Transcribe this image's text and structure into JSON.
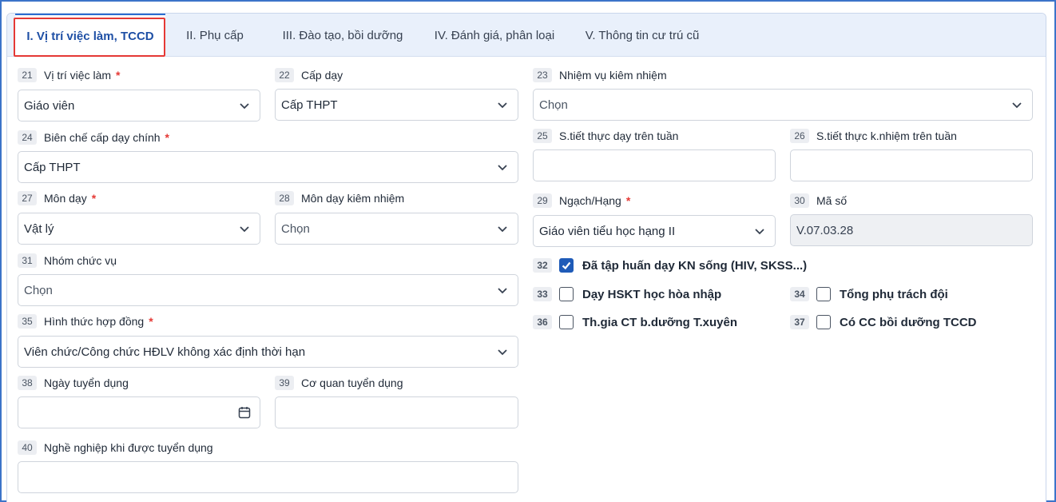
{
  "tabs": [
    {
      "label": "I. Vị trí việc làm, TCCD",
      "active": true
    },
    {
      "label": "II. Phụ cấp"
    },
    {
      "label": "III. Đào tạo, bồi dưỡng"
    },
    {
      "label": "IV. Đánh giá, phân loại"
    },
    {
      "label": "V. Thông tin cư trú cũ"
    }
  ],
  "fields": {
    "f21": {
      "num": "21",
      "label": "Vị trí việc làm",
      "required": "*",
      "value": "Giáo viên"
    },
    "f22": {
      "num": "22",
      "label": "Cấp dạy",
      "value": "Cấp THPT"
    },
    "f23": {
      "num": "23",
      "label": "Nhiệm vụ kiêm nhiệm",
      "value": "Chọn"
    },
    "f24": {
      "num": "24",
      "label": "Biên chế cấp dạy chính",
      "required": "*",
      "value": "Cấp THPT"
    },
    "f25": {
      "num": "25",
      "label": "S.tiết thực dạy trên tuần",
      "value": ""
    },
    "f26": {
      "num": "26",
      "label": "S.tiết thực k.nhiệm trên tuần",
      "value": ""
    },
    "f27": {
      "num": "27",
      "label": "Môn dạy",
      "required": "*",
      "value": "Vật lý"
    },
    "f28": {
      "num": "28",
      "label": "Môn dạy kiêm nhiệm",
      "value": "Chọn"
    },
    "f29": {
      "num": "29",
      "label": "Ngạch/Hạng",
      "required": "*",
      "value": "Giáo viên tiểu học hạng II"
    },
    "f30": {
      "num": "30",
      "label": "Mã số",
      "value": "V.07.03.28"
    },
    "f31": {
      "num": "31",
      "label": "Nhóm chức vụ",
      "value": "Chọn"
    },
    "f35": {
      "num": "35",
      "label": "Hình thức hợp đồng",
      "required": "*",
      "value": "Viên chức/Công chức HĐLV không xác định thời hạn"
    },
    "f38": {
      "num": "38",
      "label": "Ngày tuyển dụng",
      "value": ""
    },
    "f39": {
      "num": "39",
      "label": "Cơ quan tuyển dụng",
      "value": ""
    },
    "f40": {
      "num": "40",
      "label": "Nghề nghiệp khi được tuyển dụng",
      "value": ""
    }
  },
  "checks": {
    "c32": {
      "num": "32",
      "label": "Đã tập huấn dạy KN sống (HIV, SKSS...)",
      "checked": true
    },
    "c33": {
      "num": "33",
      "label": "Dạy HSKT học hòa nhập",
      "checked": false
    },
    "c34": {
      "num": "34",
      "label": "Tổng phụ trách đội",
      "checked": false
    },
    "c36": {
      "num": "36",
      "label": "Th.gia CT b.dưỡng T.xuyên",
      "checked": false
    },
    "c37": {
      "num": "37",
      "label": "Có CC bồi dưỡng TCCD",
      "checked": false
    }
  },
  "icons": {
    "select": "chevron-down-icon",
    "date": "calendar-icon",
    "check": "checkmark-icon"
  },
  "colors": {
    "accent": "#1f5bb8",
    "required": "#e53935",
    "highlight": "#e53935"
  }
}
